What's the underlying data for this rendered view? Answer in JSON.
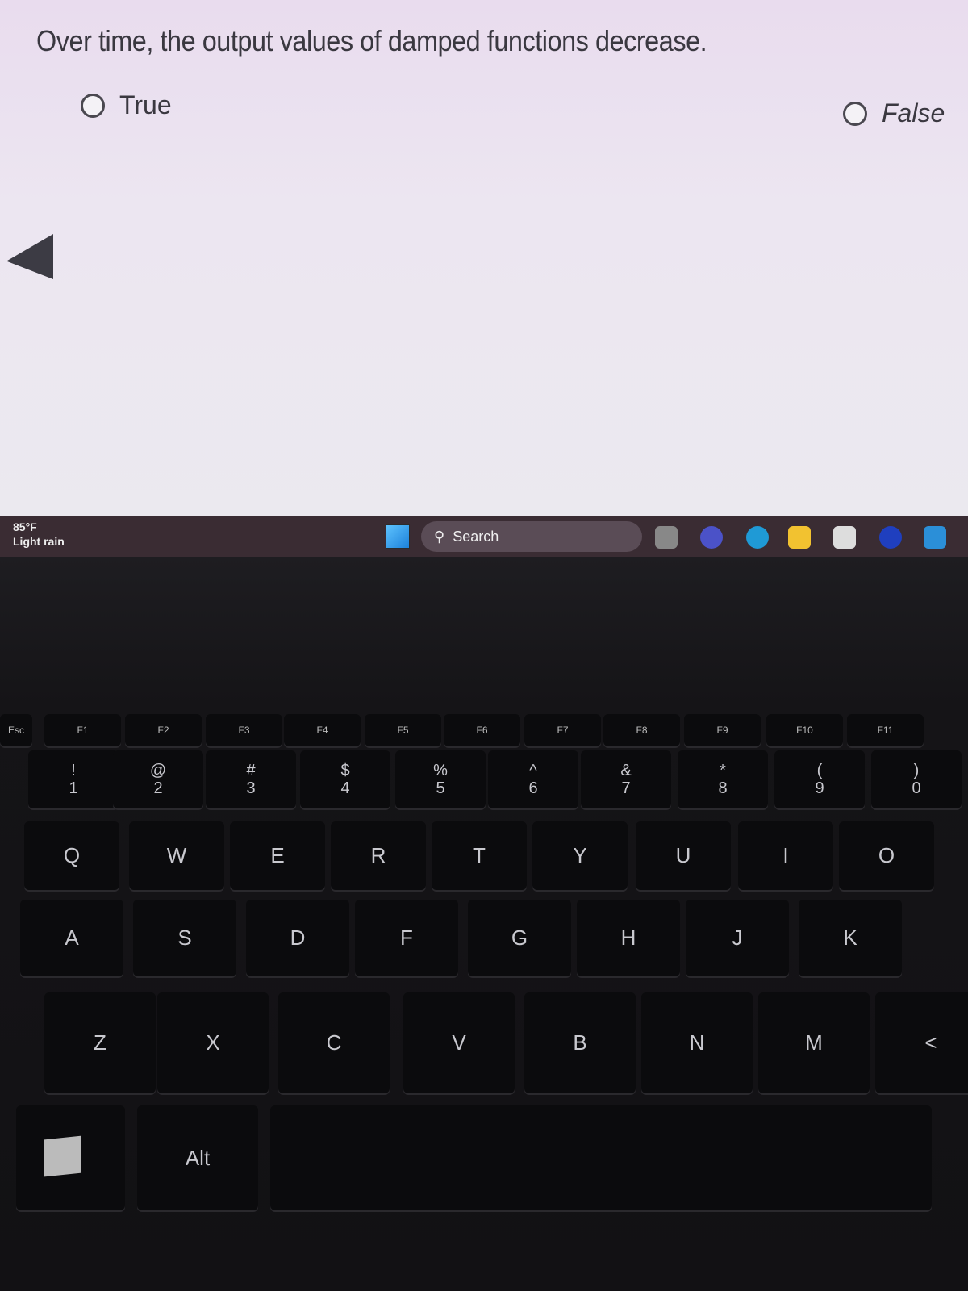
{
  "question": {
    "text": "Over time, the output values of damped functions decrease.",
    "options": [
      {
        "label": "True"
      },
      {
        "label": "False"
      }
    ]
  },
  "taskbar": {
    "weather": {
      "temp": "85°F",
      "condition": "Light rain"
    },
    "search_label": "Search",
    "icons": [
      "task-view-icon",
      "meet-icon",
      "edge-icon",
      "file-explorer-icon",
      "store-icon",
      "app-icon",
      "mail-icon"
    ]
  },
  "keyboard": {
    "fn_row": [
      "Esc",
      "F1",
      "F2",
      "F3",
      "F4",
      "F5",
      "F6",
      "F7",
      "F8",
      "F9",
      "F10",
      "F11"
    ],
    "number_row": [
      {
        "top": "!",
        "bot": "1"
      },
      {
        "top": "@",
        "bot": "2"
      },
      {
        "top": "#",
        "bot": "3"
      },
      {
        "top": "$",
        "bot": "4"
      },
      {
        "top": "%",
        "bot": "5"
      },
      {
        "top": "^",
        "bot": "6"
      },
      {
        "top": "&",
        "bot": "7"
      },
      {
        "top": "*",
        "bot": "8"
      },
      {
        "top": "(",
        "bot": "9"
      },
      {
        "top": ")",
        "bot": "0"
      }
    ],
    "q_row": [
      "Q",
      "W",
      "E",
      "R",
      "T",
      "Y",
      "U",
      "I",
      "O"
    ],
    "a_row": [
      "A",
      "S",
      "D",
      "F",
      "G",
      "H",
      "J",
      "K"
    ],
    "z_row": [
      "Z",
      "X",
      "C",
      "V",
      "B",
      "N",
      "M",
      "<"
    ],
    "bottom_row": [
      "",
      "Alt",
      ""
    ]
  }
}
